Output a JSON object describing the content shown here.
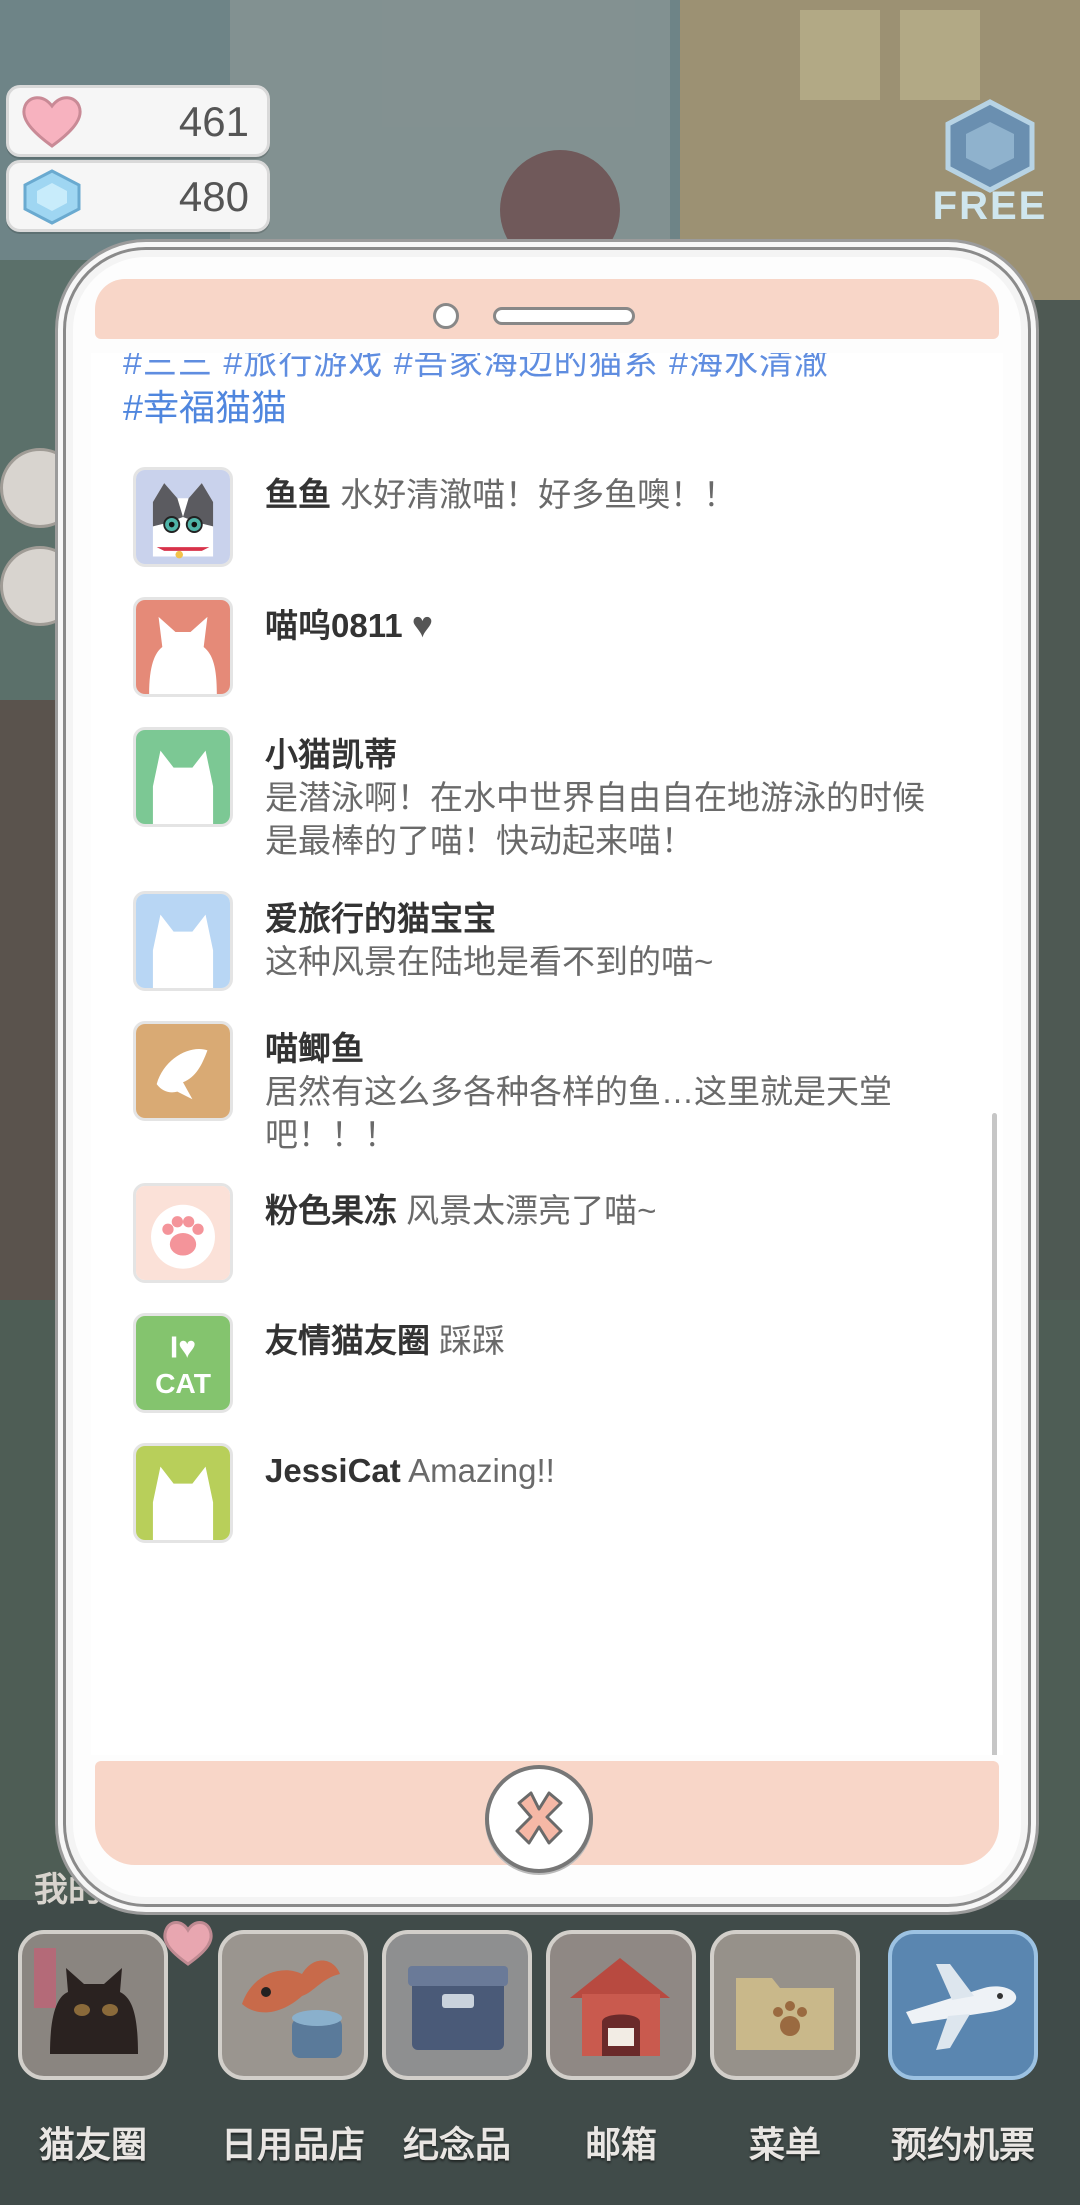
{
  "currency": {
    "hearts": "461",
    "gems": "480",
    "free_label": "FREE"
  },
  "modal": {
    "tag": "#幸福猫猫",
    "cut_tags": "#三三 #旅行游戏 #吾家海边的猫系 #海水清澈",
    "comments": [
      {
        "user": "鱼鱼",
        "text": "水好清澈喵！好多鱼噢！！",
        "avatar": "gray-tabby-cat",
        "color": "#c9d2ec"
      },
      {
        "user": "喵呜0811",
        "text": "♥",
        "avatar": "cat-silhouette",
        "color": "#e58a78"
      },
      {
        "user": "小猫凯蒂",
        "text": "是潜泳啊！在水中世界自由自在地游泳的时候是最棒的了喵！快动起来喵！",
        "avatar": "cat-silhouette",
        "color": "#7cc894"
      },
      {
        "user": "爱旅行的猫宝宝",
        "text": "这种风景在陆地是看不到的喵~",
        "avatar": "cat-silhouette",
        "color": "#b8d6f4"
      },
      {
        "user": "喵鲫鱼",
        "text": "居然有这么多各种各样的鱼…这里就是天堂吧！！！",
        "avatar": "fish-silhouette",
        "color": "#d9aa74"
      },
      {
        "user": "粉色果冻",
        "text": "风景太漂亮了喵~",
        "avatar": "paw-print",
        "color": "#fbe1d8"
      },
      {
        "user": "友情猫友圈",
        "text": "踩踩",
        "avatar": "i-love-cat",
        "color": "#84c46e"
      },
      {
        "user": "JessiCat",
        "text": "Amazing!!",
        "avatar": "cat-silhouette",
        "color": "#b8cf5a"
      }
    ]
  },
  "side_label": "我的旅",
  "dock": [
    {
      "label": "猫友圈",
      "icon": "black-cat-icon"
    },
    {
      "label": "日用品店",
      "icon": "fish-food-icon"
    },
    {
      "label": "纪念品",
      "icon": "box-icon"
    },
    {
      "label": "邮箱",
      "icon": "mailbox-house-icon"
    },
    {
      "label": "菜单",
      "icon": "folder-paw-icon"
    },
    {
      "label": "预约机票",
      "icon": "airplane-icon"
    }
  ]
}
